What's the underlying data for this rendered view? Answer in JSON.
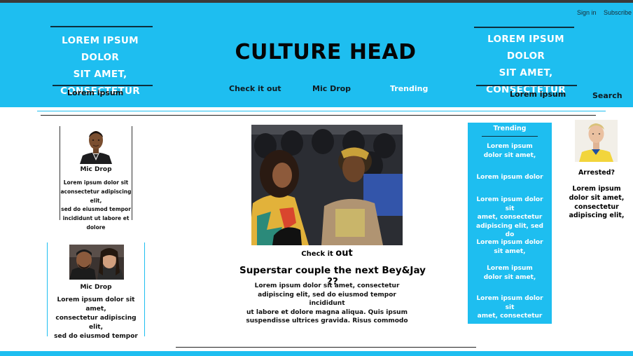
{
  "auth": {
    "signin": "Sign in",
    "subscribe": "Subscribe"
  },
  "header": {
    "title": "CULTURE HEAD",
    "left_promo": {
      "lines": [
        "LOREM IPSUM DOLOR",
        "SIT AMET,",
        "CONSECTETUR"
      ],
      "sub": "Lorem ipsum"
    },
    "right_promo": {
      "lines": [
        "LOREM IPSUM DOLOR",
        "SIT AMET,",
        "CONSECTETUR"
      ],
      "sub": "Lorem ipsum"
    },
    "nav": [
      "Check it out",
      "Mic Drop",
      "Trending"
    ],
    "search": "Search"
  },
  "left_cards": [
    {
      "icon": "portrait-man-photo",
      "title": "Mic Drop",
      "body": [
        "Lorem ipsum dolor sit",
        "aconsectetur adipiscing elit,",
        "sed do eiusmod tempor",
        "incididunt ut labore et dolore"
      ]
    },
    {
      "icon": "couple-selfie-photo",
      "title": "Mic Drop",
      "body": [
        "Lorem ipsum dolor sit amet,",
        "consectetur adipiscing elit,",
        "sed do eiusmod tempor"
      ]
    }
  ],
  "featured": {
    "icon": "couple-courtside-photo",
    "caption_small": "Check it",
    "caption_big": "out",
    "headline": "Superstar couple the next Bey&Jay ??",
    "body": [
      "Lorem ipsum dolor sit amet, consectetur",
      "adipiscing elit, sed do eiusmod tempor incididunt",
      "ut labore et dolore magna aliqua. Quis ipsum",
      "suspendisse ultrices gravida. Risus commodo"
    ]
  },
  "trending": {
    "title": "Trending",
    "items": [
      [
        "Lorem ipsum",
        "dolor sit amet,"
      ],
      [
        "Lorem ipsum dolor"
      ],
      [
        "Lorem ipsum dolor sit",
        "amet, consectetur",
        "adipiscing elit, sed do"
      ],
      [
        "Lorem ipsum dolor",
        "sit amet,"
      ],
      [
        "Lorem ipsum",
        "dolor sit amet,"
      ],
      [
        "Lorem ipsum dolor sit",
        "amet, consectetur"
      ]
    ]
  },
  "side_story": {
    "icon": "player-headshot-photo",
    "title": "Arrested?",
    "body": [
      "Lorem ipsum",
      "dolor sit amet,",
      "consectetur",
      "adipiscing elit,"
    ]
  },
  "colors": {
    "accent": "#1ebef0",
    "header_dark": "#0d2f3d"
  }
}
